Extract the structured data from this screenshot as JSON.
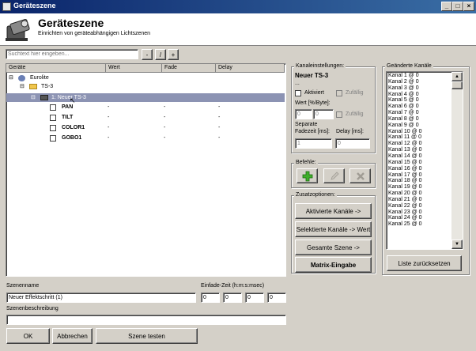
{
  "window": {
    "title": "Geräteszene"
  },
  "header": {
    "title": "Geräteszene",
    "subtitle": "Einrichten von geräteabhängigen Lichtszenen"
  },
  "search": {
    "placeholder": "Suchtext hier eingeben..."
  },
  "toolbar": {
    "minus": "-",
    "slash": "/",
    "plus": "+"
  },
  "tree": {
    "columns": [
      "Geräte",
      "Wert",
      "Fade",
      "Delay"
    ],
    "rows": [
      {
        "expander": "⊟",
        "label": "Eurolite",
        "wert": "",
        "fade": "",
        "delay": ""
      },
      {
        "expander": "⊟",
        "label": "TS-3",
        "wert": "",
        "fade": "",
        "delay": ""
      },
      {
        "expander": "⊟",
        "label": "1: Neuer TS-3",
        "wert": "",
        "fade": "",
        "delay": ""
      },
      {
        "expander": "",
        "label": "PAN",
        "wert": "-",
        "fade": "-",
        "delay": "-"
      },
      {
        "expander": "",
        "label": "TILT",
        "wert": "-",
        "fade": "-",
        "delay": "-"
      },
      {
        "expander": "",
        "label": "COLOR1",
        "wert": "-",
        "fade": "-",
        "delay": "-"
      },
      {
        "expander": "",
        "label": "GOBO1",
        "wert": "-",
        "fade": "-",
        "delay": "-"
      }
    ]
  },
  "kanal": {
    "group_label": "Kanaleinstellungen:",
    "device_name": "Neuer TS-3",
    "dots": "...",
    "aktiviert": "Aktiviert",
    "zufaellig": "Zufällig",
    "wert_label": "Wert [%/Byte]:",
    "wert_value1": "0",
    "wert_value2": "0",
    "separate_label": "Separate",
    "fadezeit_label": "Fadezeit [ms]:",
    "delay_label": "Delay [ms]:",
    "fadezeit_value": "1",
    "delay_value": "0"
  },
  "befehle": {
    "group_label": "Befehle:"
  },
  "zusatz": {
    "group_label": "Zusatzoptionen:",
    "btn1": "Aktivierte Kanäle ->",
    "btn2": "Selektierte Kanäle -> Wert",
    "btn3": "Gesamte Szene ->",
    "btn4": "Matrix-Eingabe"
  },
  "changed": {
    "group_label": "Geänderte Kanäle",
    "items": [
      "Kanal 1 @ 0",
      "Kanal 2 @ 0",
      "Kanal 3 @ 0",
      "Kanal 4 @ 0",
      "Kanal 5 @ 0",
      "Kanal 6 @ 0",
      "Kanal 7 @ 0",
      "Kanal 8 @ 0",
      "Kanal 9 @ 0",
      "Kanal 10 @ 0",
      "Kanal 11 @ 0",
      "Kanal 12 @ 0",
      "Kanal 13 @ 0",
      "Kanal 14 @ 0",
      "Kanal 15 @ 0",
      "Kanal 16 @ 0",
      "Kanal 17 @ 0",
      "Kanal 18 @ 0",
      "Kanal 19 @ 0",
      "Kanal 20 @ 0",
      "Kanal 21 @ 0",
      "Kanal 22 @ 0",
      "Kanal 23 @ 0",
      "Kanal 24 @ 0",
      "Kanal 25 @ 0"
    ],
    "reset_button": "Liste zurücksetzen"
  },
  "bottom": {
    "szenenname_label": "Szenenname",
    "szenenname_value": "Neuer Effektschritt (1)",
    "einfade_label": "Einfade-Zeit (h:m:s:msec)",
    "time_h": "0",
    "time_m": "0",
    "time_s": "0",
    "time_ms": "0",
    "beschreibung_label": "Szenenbeschreibung",
    "beschreibung_value": "",
    "ok": "OK",
    "abbrechen": "Abbrechen",
    "testen": "Szene testen"
  }
}
